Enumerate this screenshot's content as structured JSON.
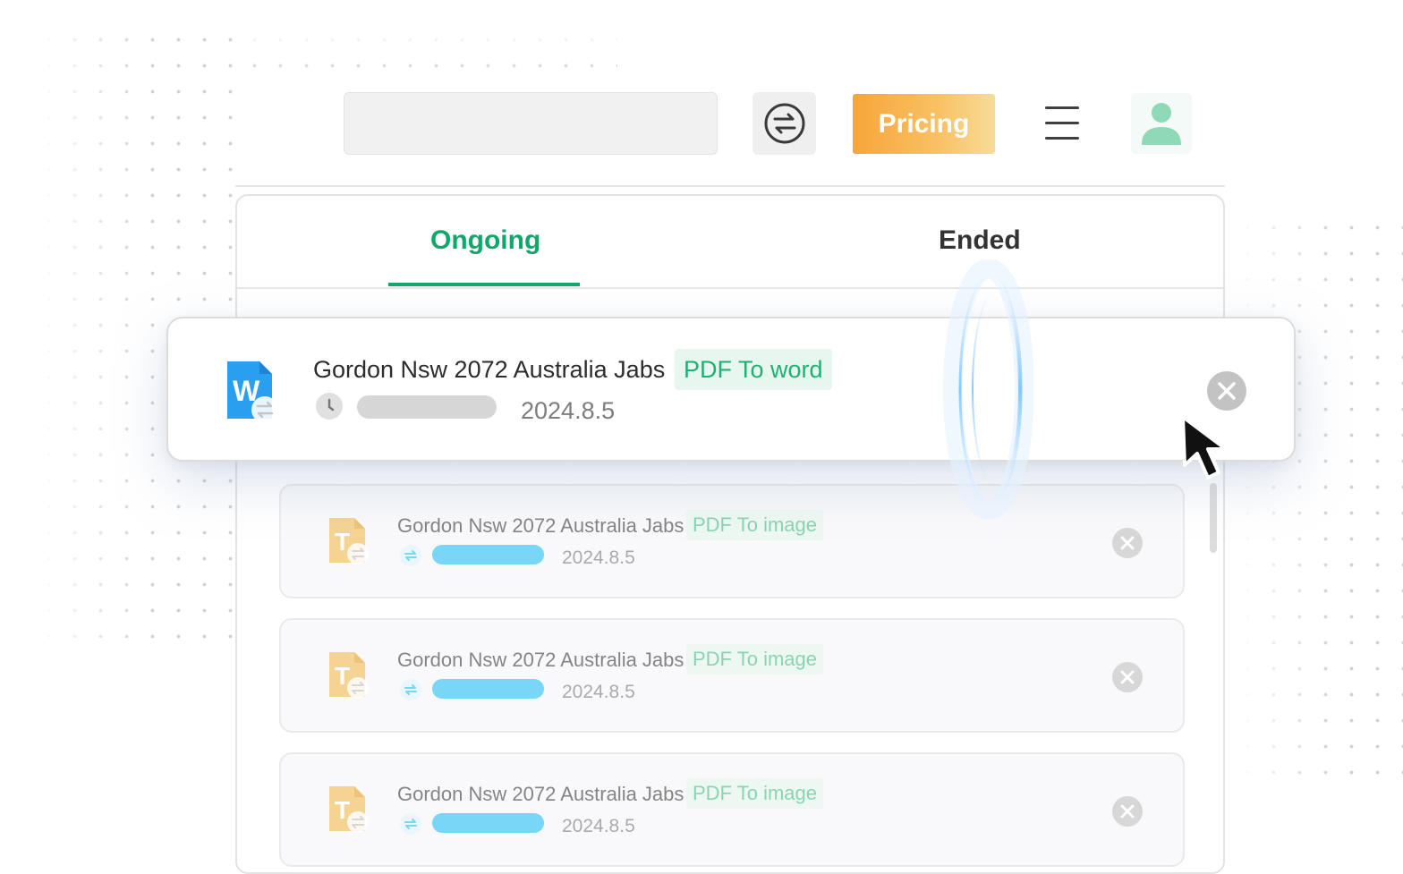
{
  "header": {
    "search": {
      "value": "",
      "placeholder": ""
    },
    "pricing_label": "Pricing"
  },
  "tabs": [
    {
      "label": "Ongoing",
      "active": true
    },
    {
      "label": "Ended",
      "active": false
    }
  ],
  "featured_task": {
    "filename": "Gordon Nsw 2072 Australia Jabs",
    "conversion": "PDF To word",
    "date": "2024.8.5",
    "status_icon": "clock-icon",
    "file_icon": "word-file-icon"
  },
  "tasks": [
    {
      "filename": "Gordon Nsw 2072 Australia Jabs",
      "conversion": "PDF To image",
      "date": "2024.8.5",
      "file_icon": "text-file-icon"
    },
    {
      "filename": "Gordon Nsw 2072 Australia Jabs",
      "conversion": "PDF To image",
      "date": "2024.8.5",
      "file_icon": "text-file-icon"
    },
    {
      "filename": "Gordon Nsw 2072 Australia Jabs",
      "conversion": "PDF To image",
      "date": "2024.8.5",
      "file_icon": "text-file-icon"
    }
  ],
  "colors": {
    "accent_green": "#10a86a",
    "pricing_orange": "#f7a53a",
    "progress_blue": "#45c8f3",
    "word_blue": "#2a9ff0"
  }
}
